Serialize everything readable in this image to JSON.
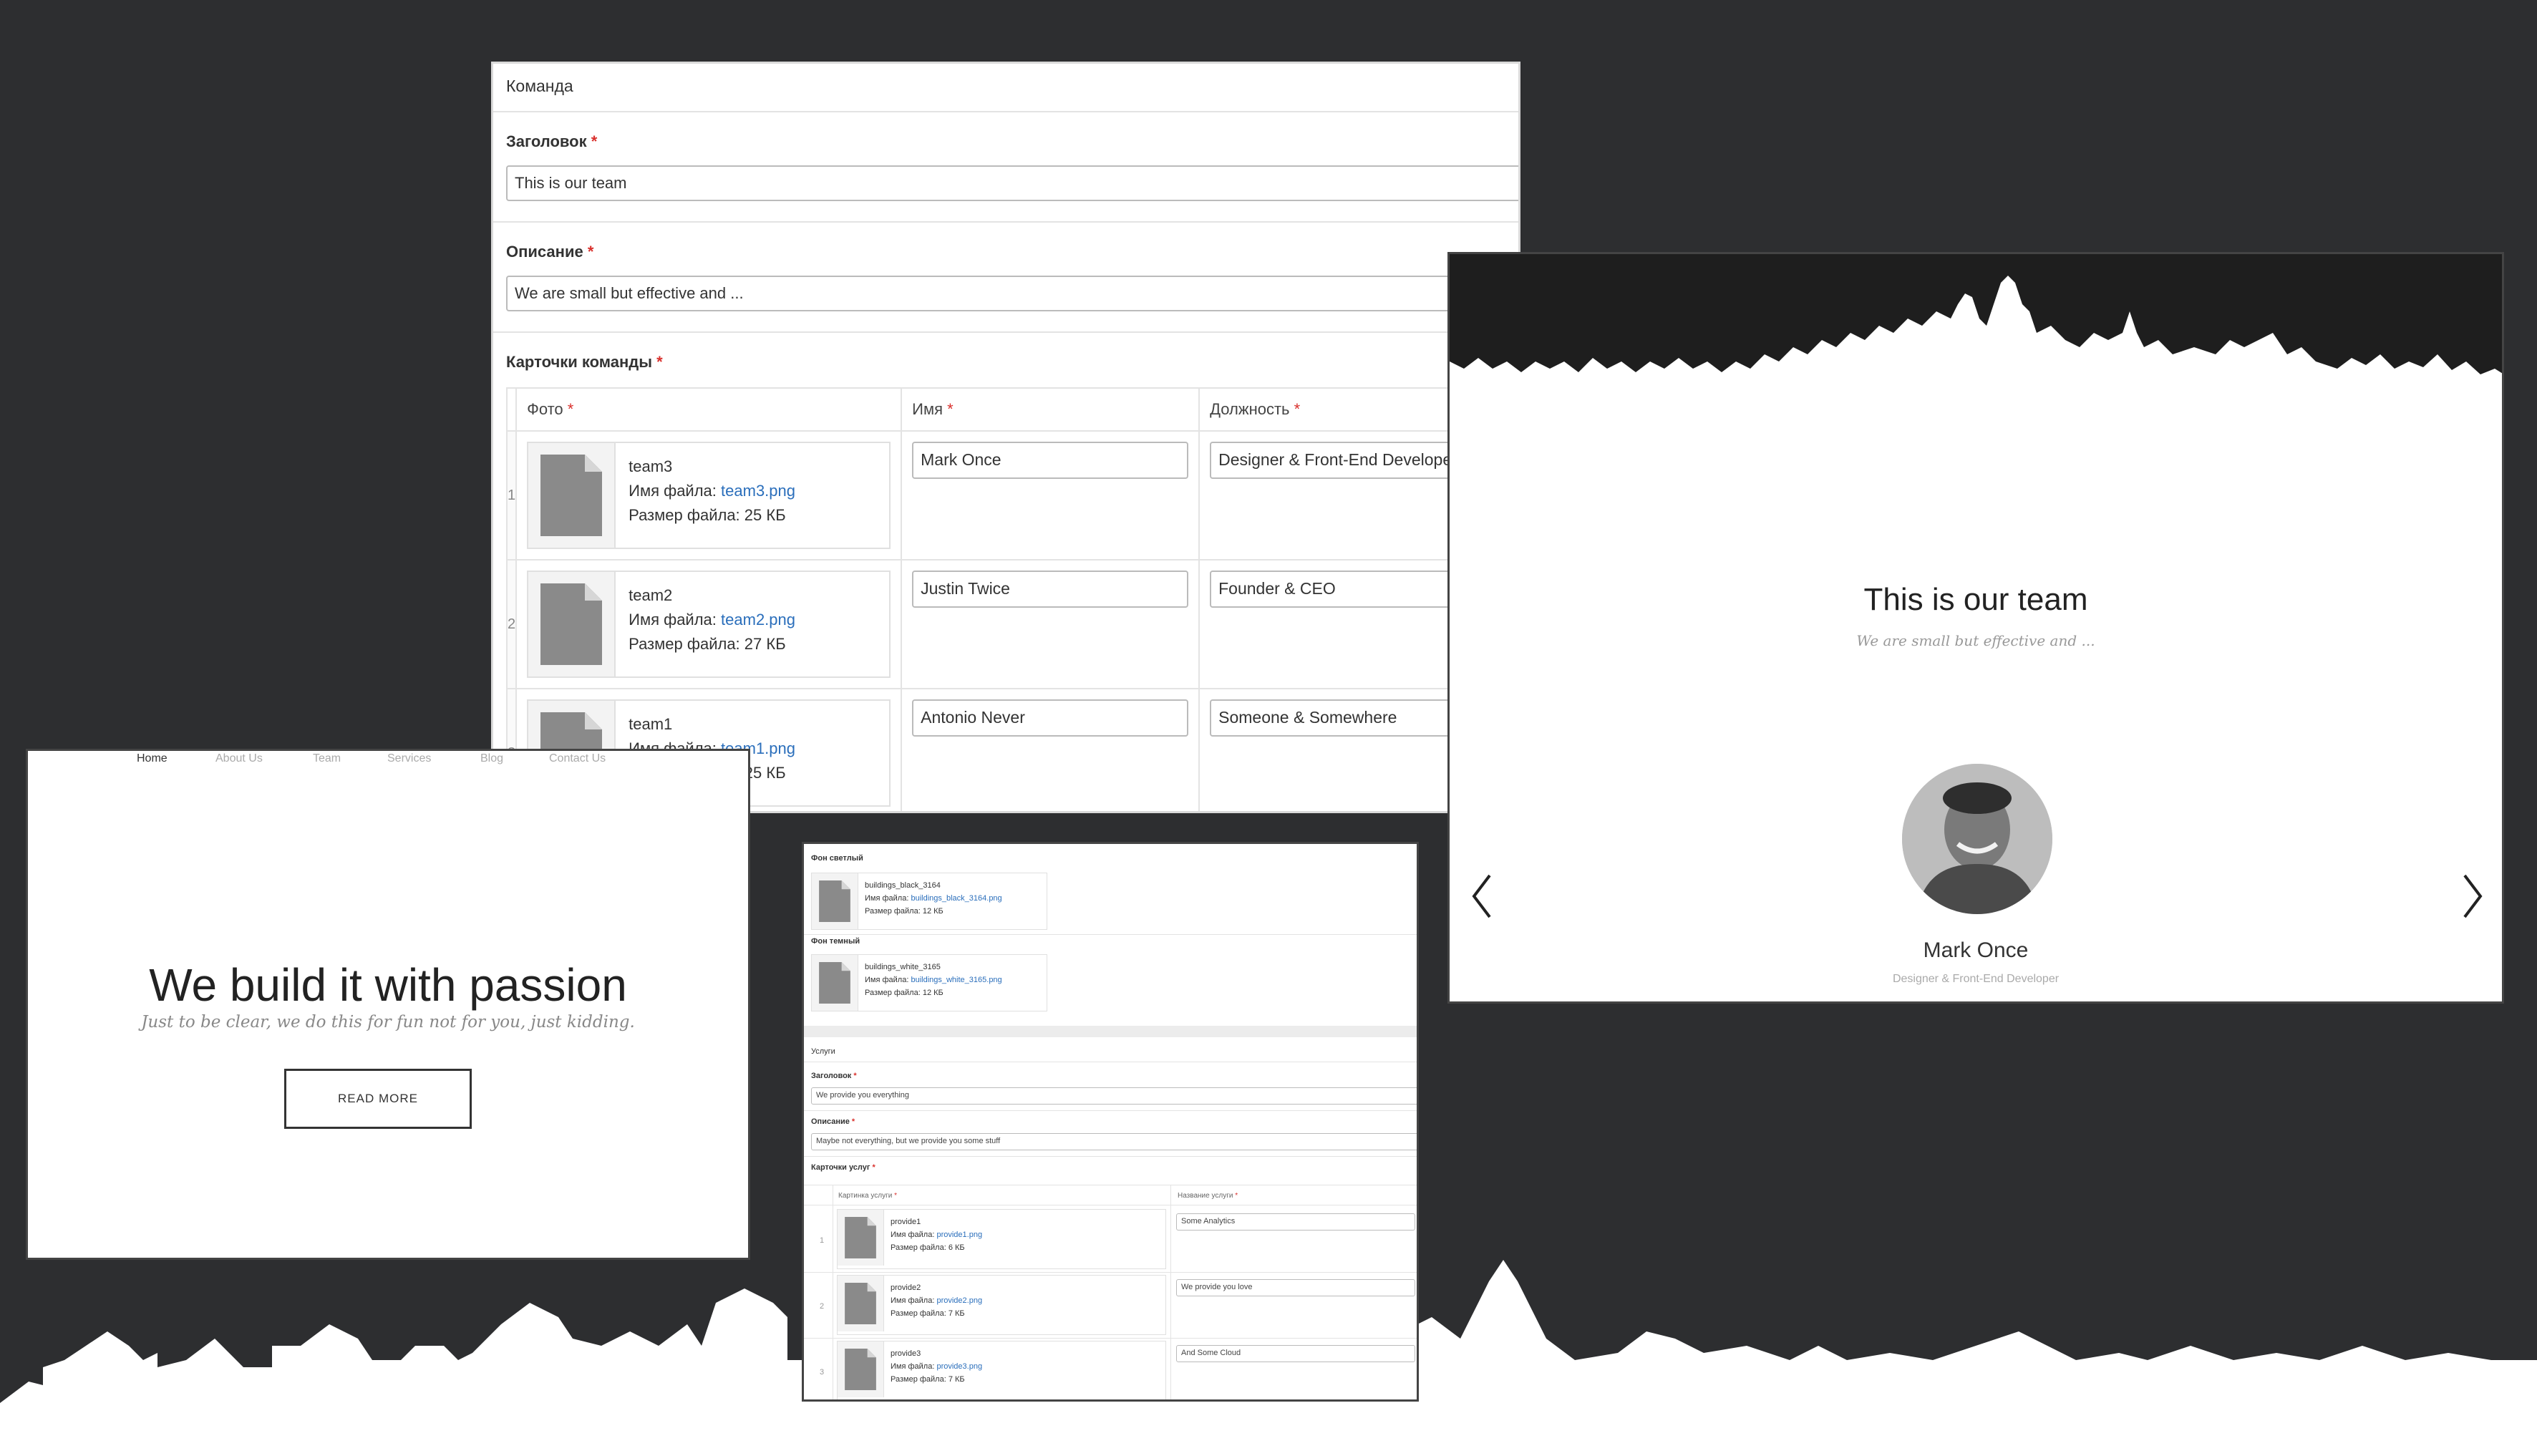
{
  "admin_team": {
    "section_title": "Команда",
    "heading_label": "Заголовок",
    "heading_value": "This is our team",
    "description_label": "Описание",
    "description_value": "We are small but effective and ...",
    "cards_label": "Карточки команды",
    "columns": {
      "photo": "Фото",
      "name": "Имя",
      "position": "Должность"
    },
    "required_mark": "*",
    "file_name_label": "Имя файла:",
    "file_size_label": "Размер файла:",
    "rows": [
      {
        "num": "1",
        "file_title": "team3",
        "file_name": "team3.png",
        "file_size": "25 КБ",
        "name": "Mark Once",
        "position": "Designer & Front-End Developer"
      },
      {
        "num": "2",
        "file_title": "team2",
        "file_name": "team2.png",
        "file_size": "27 КБ",
        "name": "Justin Twice",
        "position": "Founder & CEO"
      },
      {
        "num": "3",
        "file_title": "team1",
        "file_name": "team1.png",
        "file_size": "25 КБ",
        "name": "Antonio Never",
        "position": "Someone & Somewhere"
      }
    ]
  },
  "site_team": {
    "title": "This is our team",
    "description": "We are small but effective and ...",
    "member_name": "Mark Once",
    "member_role": "Designer & Front-End Developer"
  },
  "site_hero": {
    "nav": [
      "Home",
      "About Us",
      "Team",
      "Services",
      "Blog",
      "Contact Us"
    ],
    "headline": "We build it with passion",
    "subline": "Just to be clear, we do this for fun not for you, just kidding.",
    "button": "READ MORE"
  },
  "admin_services": {
    "bg_light_label": "Фон светлый",
    "bg_light": {
      "title": "buildings_black_3164",
      "file_name": "buildings_black_3164.png",
      "file_size": "12 КБ"
    },
    "bg_dark_label": "Фон темный",
    "bg_dark": {
      "title": "buildings_white_3165",
      "file_name": "buildings_white_3165.png",
      "file_size": "12 КБ"
    },
    "section_title": "Услуги",
    "heading_label": "Заголовок",
    "heading_value": "We provide you everything",
    "description_label": "Описание",
    "description_value": "Maybe not everything, but we provide you some stuff",
    "cards_label": "Карточки услуг",
    "col_image": "Картинка услуги",
    "col_name": "Название услуги",
    "file_name_label": "Имя файла:",
    "file_size_label": "Размер файла:",
    "rows": [
      {
        "num": "1",
        "file_title": "provide1",
        "file_name": "provide1.png",
        "file_size": "6 КБ",
        "name": "Some Analytics"
      },
      {
        "num": "2",
        "file_title": "provide2",
        "file_name": "provide2.png",
        "file_size": "7 КБ",
        "name": "We provide you love"
      },
      {
        "num": "3",
        "file_title": "provide3",
        "file_name": "provide3.png",
        "file_size": "7 КБ",
        "name": "And Some Cloud"
      }
    ]
  },
  "colors": {
    "background": "#2d2e30",
    "link": "#2a6ebb",
    "required": "#d9302c"
  }
}
